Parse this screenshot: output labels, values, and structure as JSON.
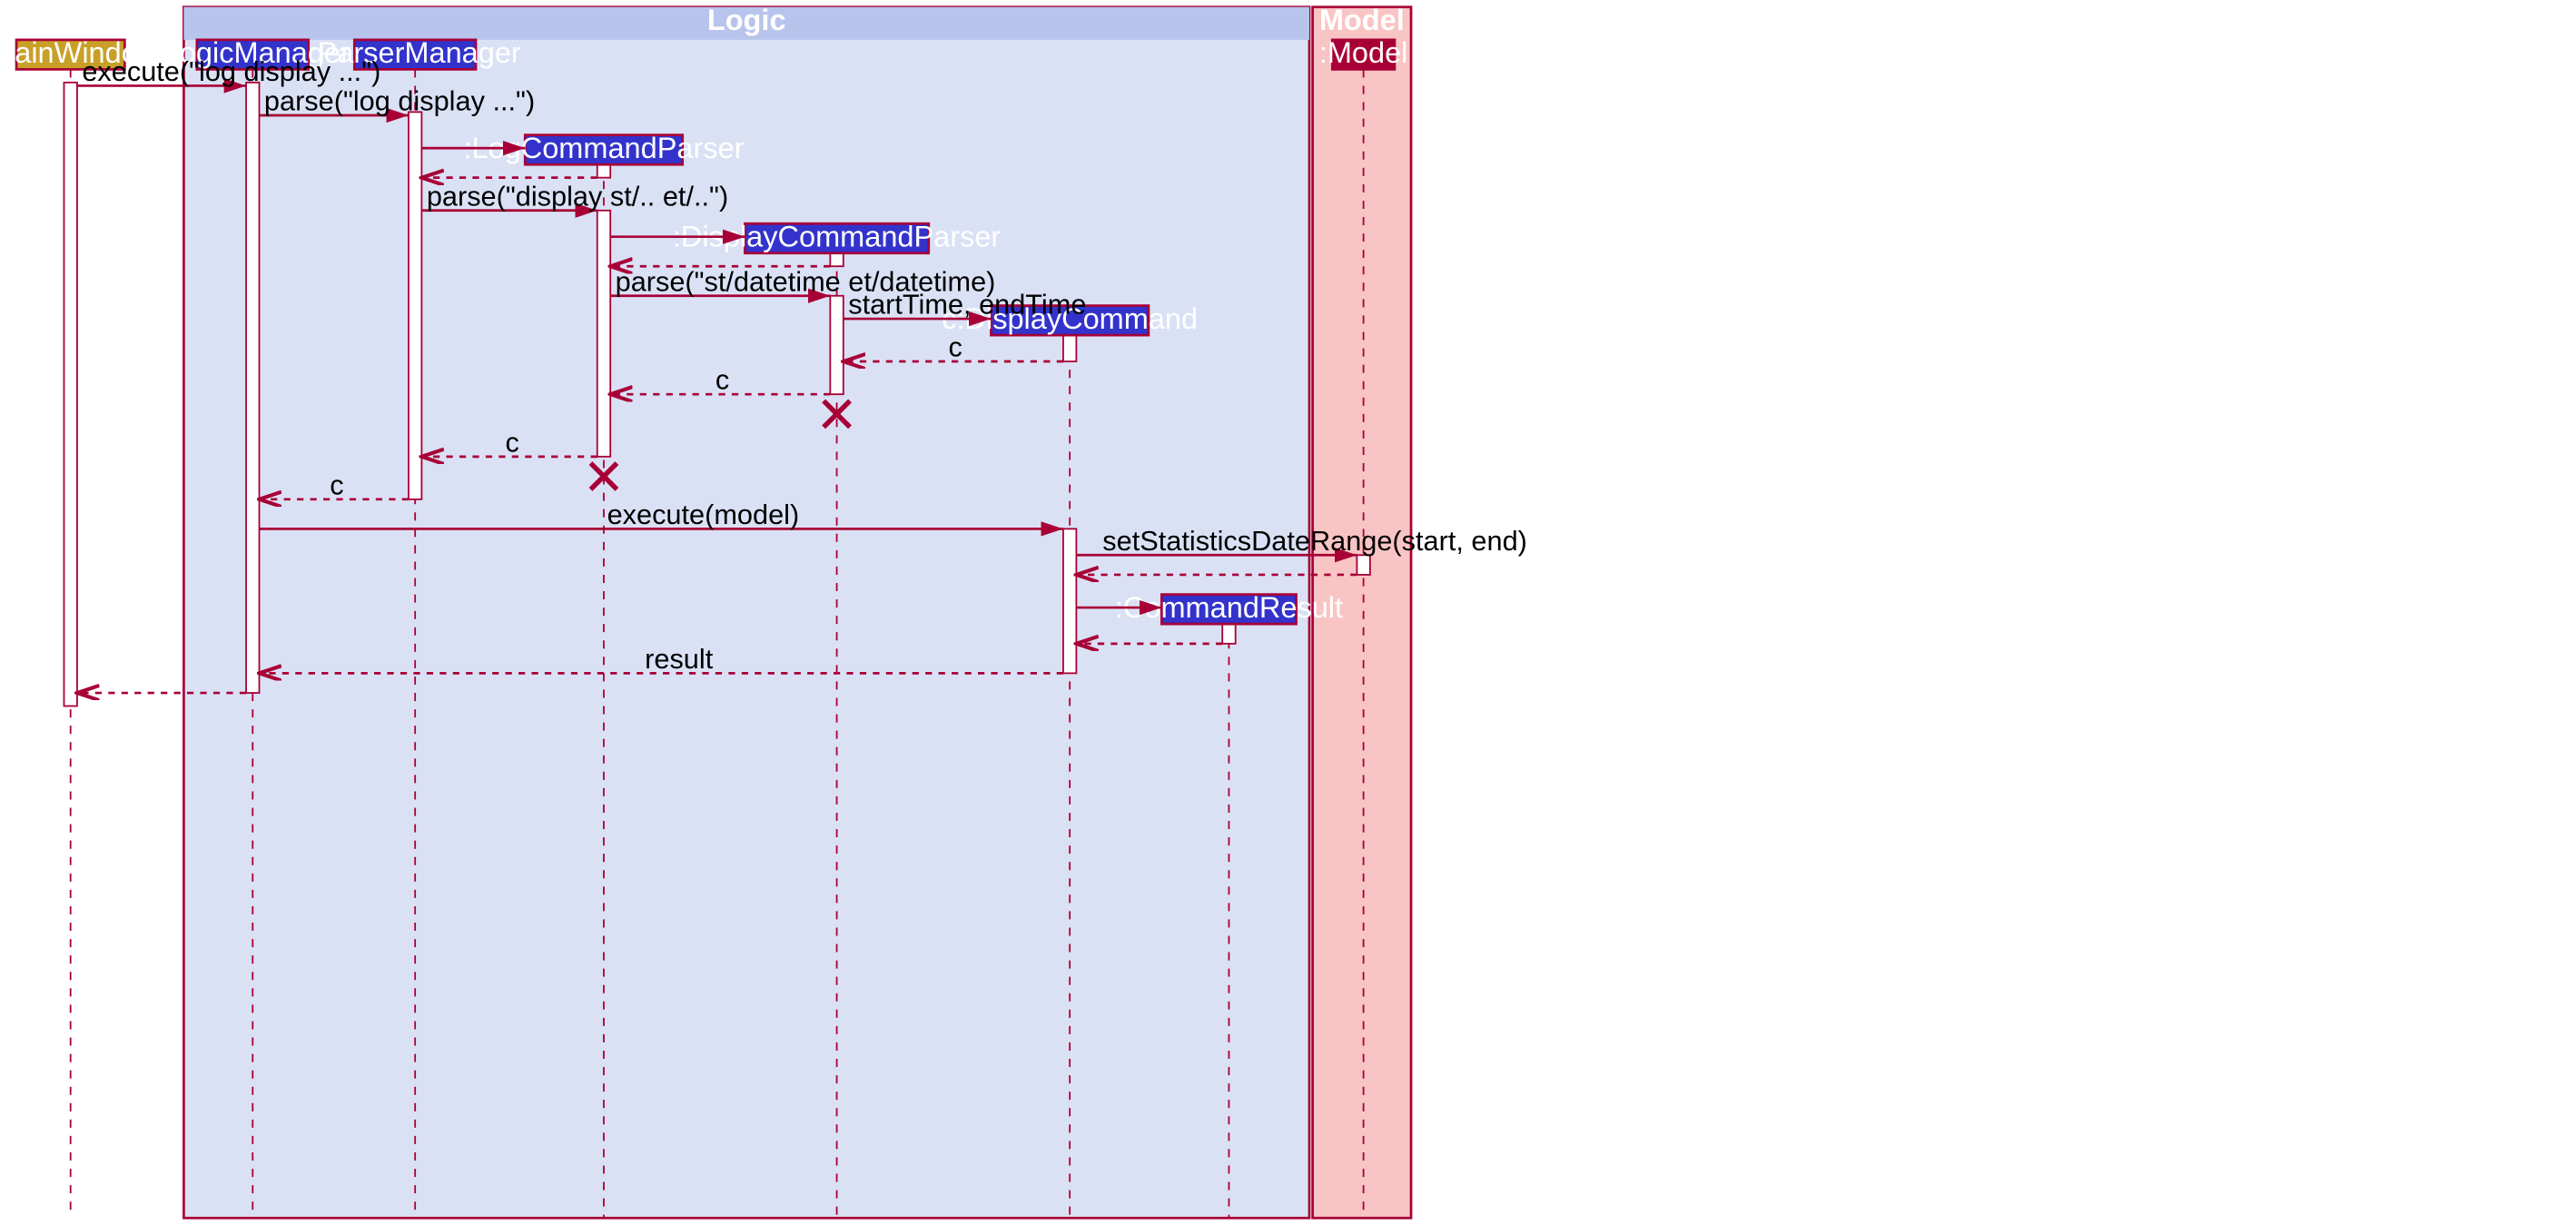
{
  "frames": {
    "logic": {
      "label": "Logic"
    },
    "model": {
      "label": "Model"
    }
  },
  "participants": {
    "mainWindow": {
      "label": ":MainWindow"
    },
    "logicManager": {
      "label": ":LogicManager"
    },
    "parserManager": {
      "label": ":ParserManager"
    },
    "logCommandParser": {
      "label": ":LogCommandParser"
    },
    "displayCommandParser": {
      "label": ":DisplayCommandParser"
    },
    "displayCommand": {
      "label": "c:DisplayCommand"
    },
    "commandResult": {
      "label": ":CommandResult"
    },
    "model": {
      "label": ":Model"
    }
  },
  "messages": {
    "m1": "execute(\"log display ...\")",
    "m2": "parse(\"log display ...\")",
    "m3": "parse(\"display st/.. et/..\")",
    "m4": "parse(\"st/datetime et/datetime)",
    "m5": "startTime, endTime",
    "m6": "c",
    "m7": "c",
    "m8": "c",
    "m9": "c",
    "m10": "execute(model)",
    "m11": "setStatisticsDateRange(start, end)",
    "m12": "result"
  },
  "chart_data": {
    "type": "sequence_diagram",
    "frames": [
      {
        "name": "Logic",
        "contains": [
          "LogicManager",
          "ParserManager",
          "LogCommandParser",
          "DisplayCommandParser",
          "DisplayCommand",
          "CommandResult"
        ]
      },
      {
        "name": "Model",
        "contains": [
          "Model"
        ]
      }
    ],
    "participants": [
      {
        "id": "MainWindow",
        "label": ":MainWindow",
        "created_at_start": true
      },
      {
        "id": "LogicManager",
        "label": ":LogicManager",
        "created_at_start": true
      },
      {
        "id": "ParserManager",
        "label": ":ParserManager",
        "created_at_start": true
      },
      {
        "id": "LogCommandParser",
        "label": ":LogCommandParser",
        "created_at_start": false
      },
      {
        "id": "DisplayCommandParser",
        "label": ":DisplayCommandParser",
        "created_at_start": false,
        "destroyed": true
      },
      {
        "id": "DisplayCommand",
        "label": "c:DisplayCommand",
        "created_at_start": false
      },
      {
        "id": "CommandResult",
        "label": ":CommandResult",
        "created_at_start": false
      },
      {
        "id": "Model",
        "label": ":Model",
        "created_at_start": true
      }
    ],
    "messages": [
      {
        "from": "MainWindow",
        "to": "LogicManager",
        "label": "execute(\"log display ...\")",
        "type": "sync"
      },
      {
        "from": "LogicManager",
        "to": "ParserManager",
        "label": "parse(\"log display ...\")",
        "type": "sync"
      },
      {
        "from": "ParserManager",
        "to": "LogCommandParser",
        "label": "",
        "type": "create"
      },
      {
        "from": "LogCommandParser",
        "to": "ParserManager",
        "label": "",
        "type": "return"
      },
      {
        "from": "ParserManager",
        "to": "LogCommandParser",
        "label": "parse(\"display st/.. et/..\")",
        "type": "sync"
      },
      {
        "from": "LogCommandParser",
        "to": "DisplayCommandParser",
        "label": "",
        "type": "create"
      },
      {
        "from": "DisplayCommandParser",
        "to": "LogCommandParser",
        "label": "",
        "type": "return"
      },
      {
        "from": "LogCommandParser",
        "to": "DisplayCommandParser",
        "label": "parse(\"st/datetime et/datetime)",
        "type": "sync"
      },
      {
        "from": "DisplayCommandParser",
        "to": "DisplayCommand",
        "label": "startTime, endTime",
        "type": "create"
      },
      {
        "from": "DisplayCommand",
        "to": "DisplayCommandParser",
        "label": "c",
        "type": "return"
      },
      {
        "from": "DisplayCommandParser",
        "to": "LogCommandParser",
        "label": "c",
        "type": "return"
      },
      {
        "from": "DisplayCommandParser",
        "to": null,
        "label": "",
        "type": "destroy"
      },
      {
        "from": "LogCommandParser",
        "to": "ParserManager",
        "label": "c",
        "type": "return"
      },
      {
        "from": "LogCommandParser",
        "to": null,
        "label": "",
        "type": "destroy"
      },
      {
        "from": "ParserManager",
        "to": "LogicManager",
        "label": "c",
        "type": "return"
      },
      {
        "from": "LogicManager",
        "to": "DisplayCommand",
        "label": "execute(model)",
        "type": "sync"
      },
      {
        "from": "DisplayCommand",
        "to": "Model",
        "label": "setStatisticsDateRange(start, end)",
        "type": "sync"
      },
      {
        "from": "Model",
        "to": "DisplayCommand",
        "label": "",
        "type": "return"
      },
      {
        "from": "DisplayCommand",
        "to": "CommandResult",
        "label": "",
        "type": "create"
      },
      {
        "from": "CommandResult",
        "to": "DisplayCommand",
        "label": "",
        "type": "return"
      },
      {
        "from": "DisplayCommand",
        "to": "LogicManager",
        "label": "result",
        "type": "return"
      },
      {
        "from": "LogicManager",
        "to": "MainWindow",
        "label": "",
        "type": "return"
      }
    ]
  }
}
